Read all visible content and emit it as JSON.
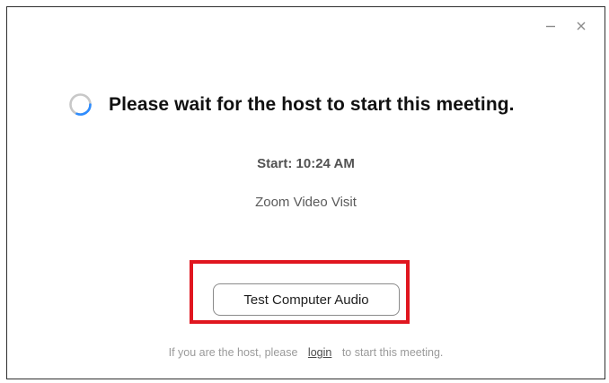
{
  "colors": {
    "accent_blue": "#2f6fc6",
    "highlight_red": "#e0161f",
    "spinner_blue": "#2d8cff"
  },
  "window": {
    "minimize_icon": "minimize-icon",
    "close_icon": "close-icon"
  },
  "waiting": {
    "spinner_icon": "loading-spinner-icon",
    "title": "Please wait for the host to start this meeting."
  },
  "meeting": {
    "start": "Start: 10:24 AM",
    "name": "Zoom Video Visit"
  },
  "actions": {
    "test_audio_label": "Test Computer Audio"
  },
  "footer": {
    "prefix": "If you are the host, please",
    "login_label": "login",
    "suffix": "to start this meeting."
  }
}
